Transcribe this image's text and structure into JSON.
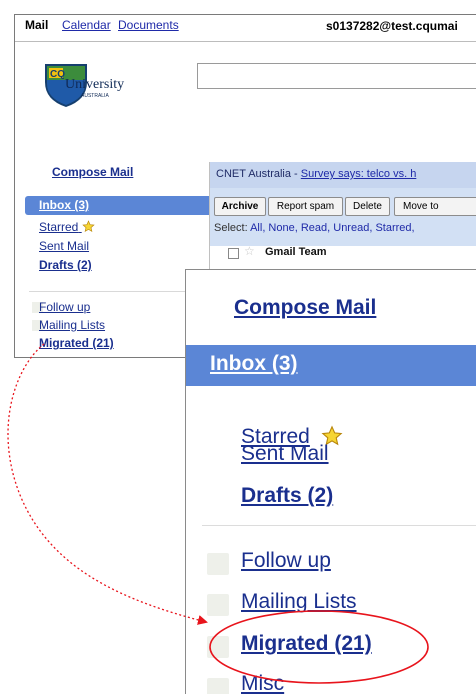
{
  "topbar": {
    "mail": "Mail",
    "calendar": "Calendar",
    "documents": "Documents",
    "account": "s0137282@test.cqumai"
  },
  "logo": {
    "cq": "CQ",
    "university": "University",
    "australia": "AUSTRALIA"
  },
  "sidebar": {
    "compose": "Compose Mail",
    "inbox": "Inbox (3)",
    "starred": "Starred",
    "sent": "Sent Mail",
    "drafts": "Drafts (2)",
    "labels": [
      {
        "label": "Follow up"
      },
      {
        "label": "Mailing Lists"
      },
      {
        "label": "Migrated (21)"
      }
    ]
  },
  "message_pane": {
    "ad_source": "CNET Australia -",
    "ad_link": "Survey says: telco vs. h",
    "buttons": [
      "Archive",
      "Report spam",
      "Delete",
      "Move to"
    ],
    "select_prefix": "Select:",
    "select_links": "All, None, Read, Unread, Starred,",
    "first_sender": "Gmail Team"
  },
  "zoom": {
    "compose": "Compose Mail",
    "inbox": "Inbox (3)",
    "starred": "Starred",
    "sent": "Sent Mail",
    "drafts": "Drafts (2)",
    "follow_up": "Follow up",
    "mailing_lists": "Mailing Lists",
    "migrated": "Migrated (21)",
    "misc": "Misc"
  },
  "colors": {
    "selection_blue": "#5b86d6",
    "link_blue": "#1a2f8e",
    "highlight_red": "#e8141c",
    "star_yellow": "#f6d534"
  }
}
